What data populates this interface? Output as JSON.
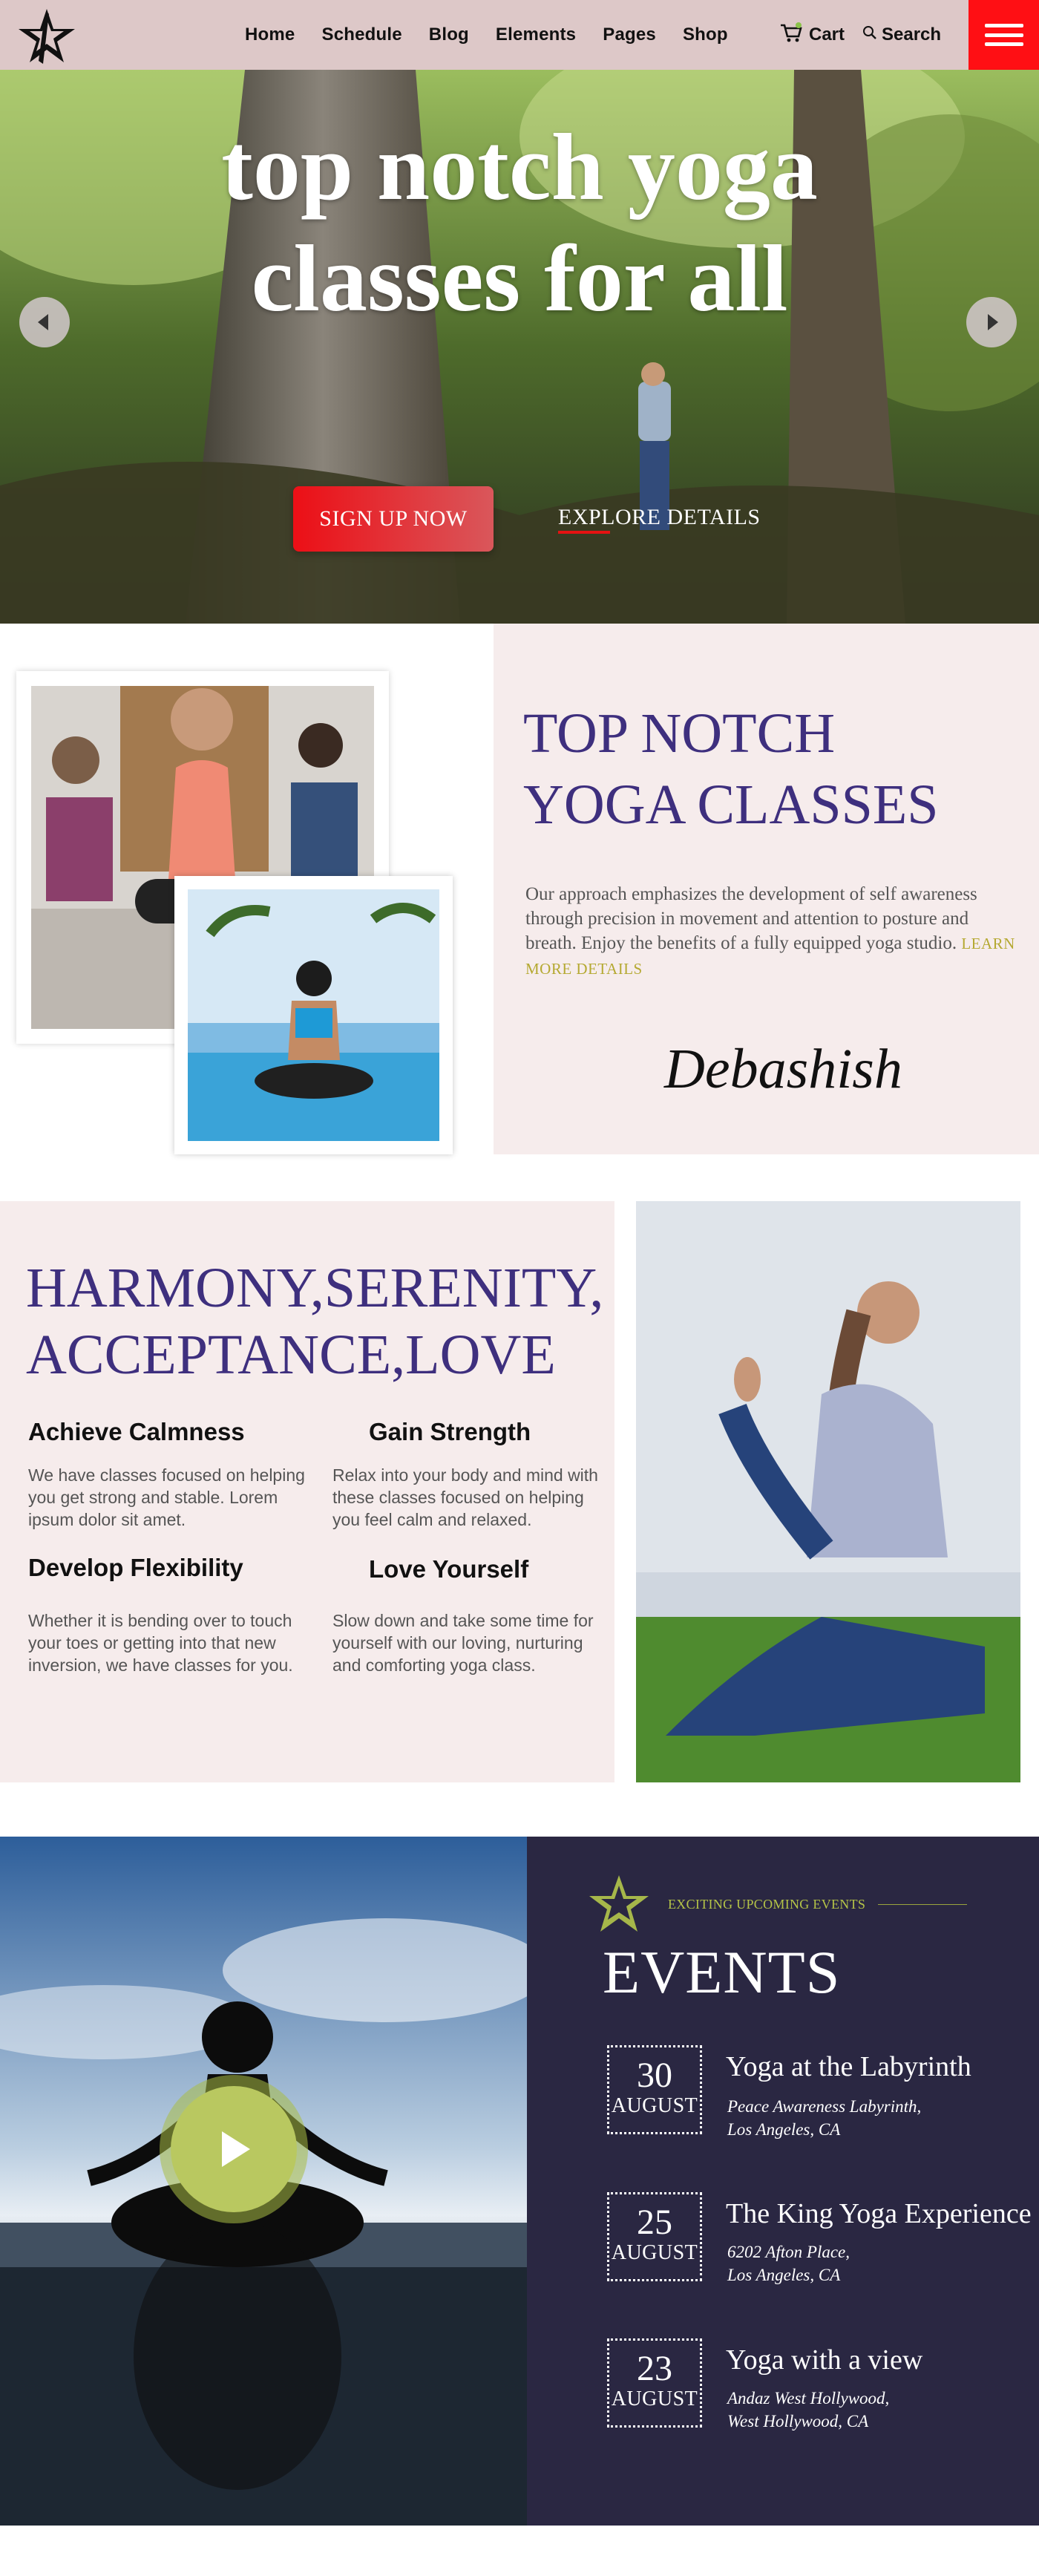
{
  "nav": {
    "items": [
      "Home",
      "Schedule",
      "Blog",
      "Elements",
      "Pages",
      "Shop"
    ],
    "cart_label": "Cart",
    "search_label": "Search"
  },
  "hero": {
    "title_line1": "top notch yoga",
    "title_line2": "classes for all",
    "signup_label": "SIGN UP NOW",
    "explore_label": "EXPLORE DETAILS"
  },
  "about": {
    "title_line1": "TOP NOTCH",
    "title_line2": "YOGA CLASSES",
    "text": "Our approach emphasizes the development of self awareness through precision in movement and attention to posture and breath. Enjoy the benefits of a fully equipped yoga studio.",
    "link_label": "LEARN MORE DETAILS",
    "signature": "Debashish"
  },
  "features": {
    "title_line1": "HARMONY,SERENITY,",
    "title_line2": "ACCEPTANCE,LOVE",
    "items": [
      {
        "title": "Achieve Calmness",
        "text": "We have classes focused on helping you get strong and stable. Lorem ipsum dolor sit amet."
      },
      {
        "title": "Gain Strength",
        "text": "Relax into your body and mind with these classes focused on helping you feel calm and relaxed."
      },
      {
        "title": "Develop Flexibility",
        "text": "Whether it is bending over to touch your toes or getting into that new inversion, we have classes for you."
      },
      {
        "title": "Love Yourself",
        "text": "Slow down and take some time for yourself with our loving, nurturing and comforting yoga class."
      }
    ]
  },
  "events": {
    "subtitle": "EXCITING UPCOMING EVENTS",
    "title": "EVENTS",
    "items": [
      {
        "day": "30",
        "month": "AUGUST",
        "title": "Yoga at the Labyrinth",
        "addr1": "Peace Awareness Labyrinth,",
        "addr2": "Los Angeles, CA"
      },
      {
        "day": "25",
        "month": "AUGUST",
        "title": "The King Yoga Experience",
        "addr1": "6202 Afton Place,",
        "addr2": "Los Angeles, CA"
      },
      {
        "day": "23",
        "month": "AUGUST",
        "title": "Yoga with a view",
        "addr1": "Andaz West Hollywood,",
        "addr2": "West Hollywood, CA"
      }
    ]
  },
  "colors": {
    "header_bg": "#ddc8c8",
    "accent_red": "#ff0f14",
    "brand_purple": "#3e2f7e",
    "events_bg": "#2a2742",
    "olive": "#b5c447",
    "panel_pink": "#f6ecec"
  },
  "icons": {
    "logo": "star-logo-icon",
    "cart": "cart-icon",
    "search": "search-icon",
    "menu": "hamburger-icon",
    "play": "play-icon"
  }
}
